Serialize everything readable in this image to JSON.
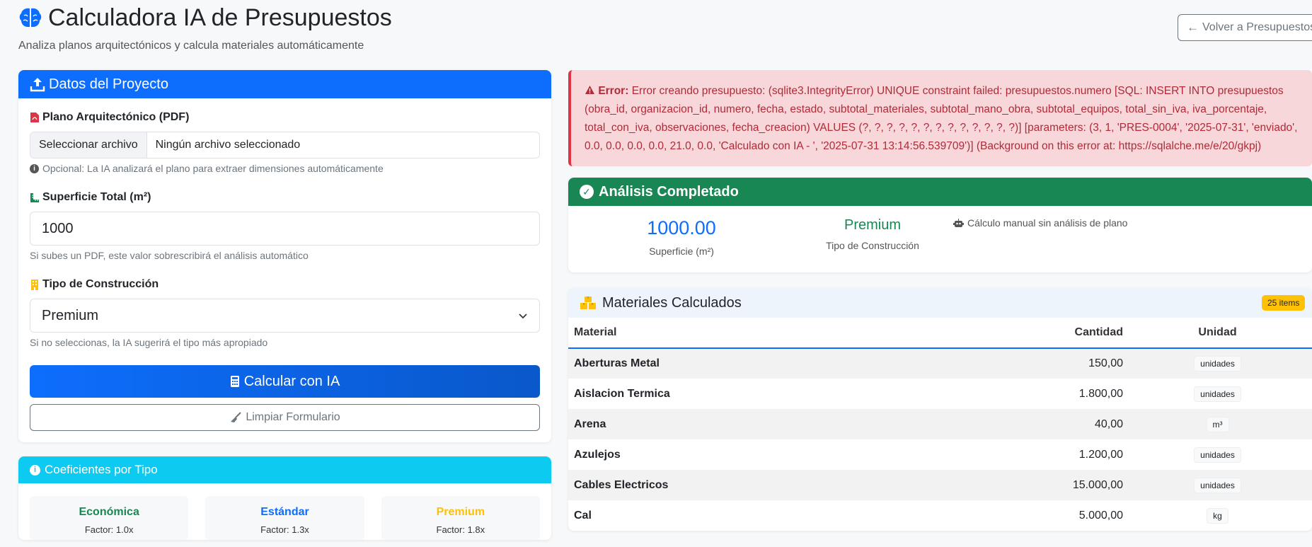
{
  "header": {
    "title": "Calculadora IA de Presupuestos",
    "subtitle": "Analiza planos arquitectónicos y calcula materiales automáticamente",
    "back_button": "Volver a Presupuestos"
  },
  "project_form": {
    "title": "Datos del Proyecto",
    "pdf_label": "Plano Arquitectónico (PDF)",
    "file_button": "Seleccionar archivo",
    "file_status": "Ningún archivo seleccionado",
    "pdf_help": "Opcional: La IA analizará el plano para extraer dimensiones automáticamente",
    "surface_label": "Superficie Total (m²)",
    "surface_value": "1000",
    "surface_help": "Si subes un PDF, este valor sobrescribirá el análisis automático",
    "type_label": "Tipo de Construcción",
    "type_value": "Premium",
    "type_help": "Si no seleccionas, la IA sugerirá el tipo más apropiado",
    "calculate_button": "Calcular con IA",
    "clear_button": "Limpiar Formulario"
  },
  "coefficients": {
    "title": "Coeficientes por Tipo",
    "items": [
      {
        "name": "Económica",
        "factor": "Factor: 1.0x",
        "color": "#198754"
      },
      {
        "name": "Estándar",
        "factor": "Factor: 1.3x",
        "color": "#0d6efd"
      },
      {
        "name": "Premium",
        "factor": "Factor: 1.8x",
        "color": "#ffc107"
      }
    ]
  },
  "error": {
    "prefix": "Error:",
    "message": "Error creando presupuesto: (sqlite3.IntegrityError) UNIQUE constraint failed: presupuestos.numero [SQL: INSERT INTO presupuestos (obra_id, organizacion_id, numero, fecha, estado, subtotal_materiales, subtotal_mano_obra, subtotal_equipos, total_sin_iva, iva_porcentaje, total_con_iva, observaciones, fecha_creacion) VALUES (?, ?, ?, ?, ?, ?, ?, ?, ?, ?, ?, ?, ?)] [parameters: (3, 1, 'PRES-0004', '2025-07-31', 'enviado', 0.0, 0.0, 0.0, 0.0, 21.0, 0.0, 'Calculado con IA - ', '2025-07-31 13:14:56.539709')] (Background on this error at: https://sqlalche.me/e/20/gkpj)"
  },
  "analysis": {
    "title": "Análisis Completado",
    "surface_value": "1000.00",
    "surface_label": "Superficie (m²)",
    "type_value": "Premium",
    "type_label": "Tipo de Construcción",
    "note": "Cálculo manual sin análisis de plano"
  },
  "materials": {
    "title": "Materiales Calculados",
    "count_badge": "25 items",
    "columns": {
      "material": "Material",
      "quantity": "Cantidad",
      "unit": "Unidad"
    },
    "rows": [
      {
        "material": "Aberturas Metal",
        "quantity": "150,00",
        "unit": "unidades"
      },
      {
        "material": "Aislacion Termica",
        "quantity": "1.800,00",
        "unit": "unidades"
      },
      {
        "material": "Arena",
        "quantity": "40,00",
        "unit": "m³"
      },
      {
        "material": "Azulejos",
        "quantity": "1.200,00",
        "unit": "unidades"
      },
      {
        "material": "Cables Electricos",
        "quantity": "15.000,00",
        "unit": "unidades"
      },
      {
        "material": "Cal",
        "quantity": "5.000,00",
        "unit": "kg"
      }
    ]
  },
  "colors": {
    "primary": "#0d6efd",
    "success": "#198754",
    "info": "#0dcaf0",
    "warning": "#ffc107",
    "danger": "#dc3545"
  }
}
